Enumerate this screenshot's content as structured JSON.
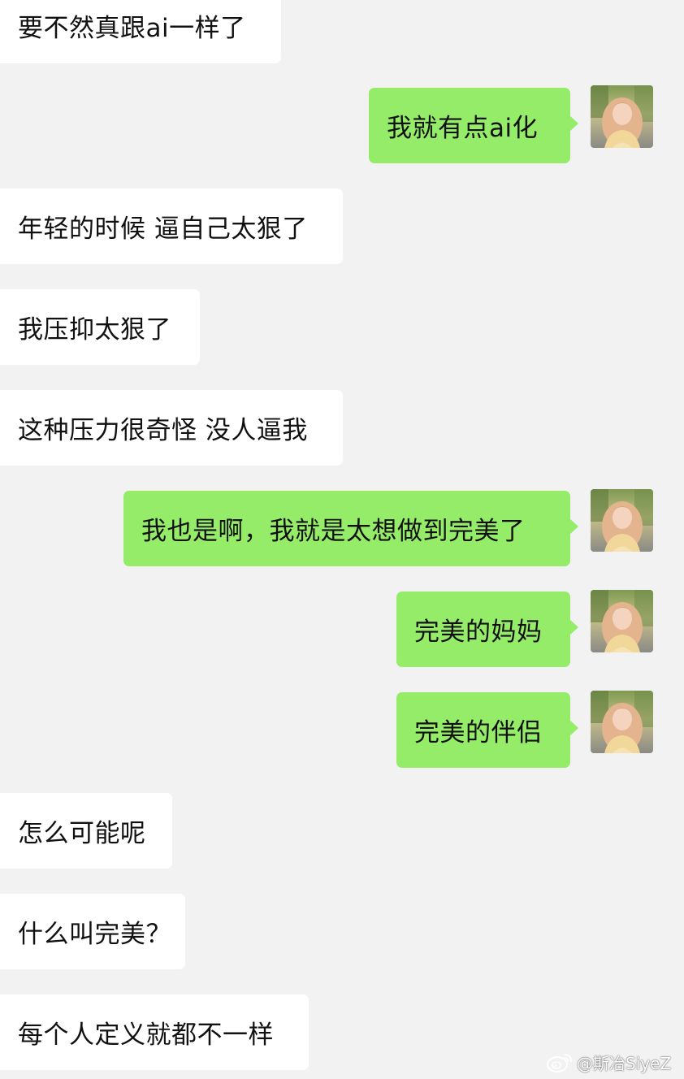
{
  "messages": [
    {
      "side": "left",
      "text": "要不然真跟ai一样了"
    },
    {
      "side": "right",
      "text": "我就有点ai化"
    },
    {
      "side": "left",
      "text": "年轻的时候 逼自己太狠了"
    },
    {
      "side": "left",
      "text": "我压抑太狠了"
    },
    {
      "side": "left",
      "text": "这种压力很奇怪 没人逼我"
    },
    {
      "side": "right",
      "text": "我也是啊，我就是太想做到完美了"
    },
    {
      "side": "right",
      "text": "完美的妈妈"
    },
    {
      "side": "right",
      "text": "完美的伴侣"
    },
    {
      "side": "left",
      "text": "怎么可能呢"
    },
    {
      "side": "left",
      "text": "什么叫完美？"
    },
    {
      "side": "left",
      "text": "每个人定义就都不一样"
    }
  ],
  "watermark": {
    "icon": "weibo-logo-icon",
    "text": "@斯冶SiyeZ"
  },
  "colors": {
    "background": "#f2f2f2",
    "incoming_bubble": "#ffffff",
    "outgoing_bubble": "#95ec69",
    "text": "#111111"
  }
}
